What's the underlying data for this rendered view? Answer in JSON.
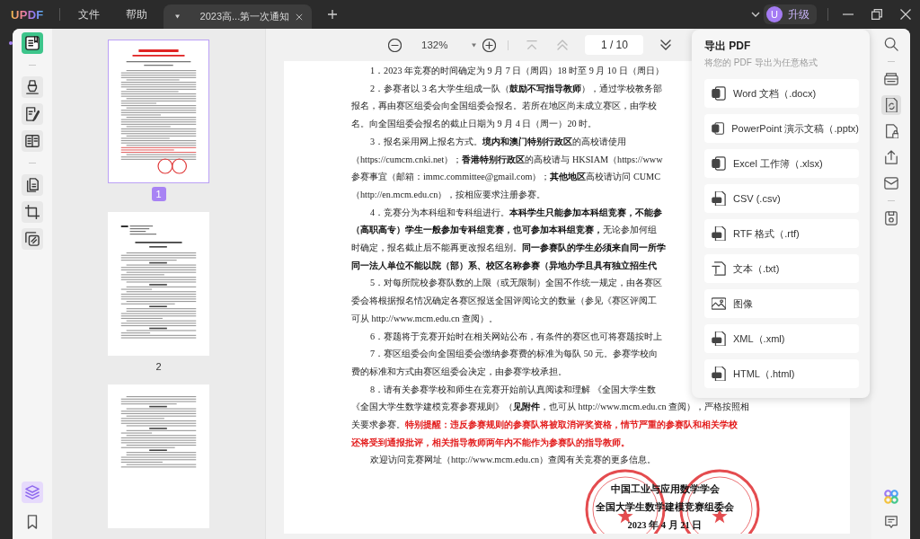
{
  "title_bar": {
    "logo": "UPDF",
    "menus": [
      {
        "label": "文件"
      },
      {
        "label": "帮助"
      }
    ],
    "tabs": [
      {
        "title": "2023高...第一次通知",
        "selected": true
      }
    ],
    "upgrade": {
      "avatar": "U",
      "label": "升级"
    }
  },
  "left_toolbar": {
    "groups": [
      {
        "tools": [
          {
            "selected": true
          }
        ]
      },
      {
        "tools": [
          {
            "selected": false
          },
          {
            "selected": false
          },
          {
            "selected": false
          }
        ]
      },
      {
        "tools": [
          {
            "selected": false
          },
          {
            "selected": false
          },
          {
            "selected": false
          }
        ]
      }
    ],
    "bottom_tools": [
      {
        "selected": true
      },
      {
        "selected": false
      }
    ]
  },
  "thumbnails": [
    {
      "label": "1",
      "selected": true
    },
    {
      "label": "2",
      "selected": false
    },
    {
      "selected": false
    }
  ],
  "doc_toolbar": {
    "zoom": "132%",
    "first_page": {
      "disabled": true
    },
    "previous_page": {
      "disabled": true
    },
    "page_field": {
      "value": "1 / 10"
    },
    "next_page": {
      "disabled": false
    }
  },
  "document": {
    "lines": [
      {
        "indent": true,
        "segments": [
          {
            "kind": "plain",
            "text": "1．2023 年竞赛的时间确定为 9 月 7 日（周四）18 时至 9 月 10 日（周日）"
          }
        ]
      },
      {
        "indent": true,
        "segments": [
          {
            "kind": "plain",
            "text": "2．参赛者以 3 名大学生组成一队（"
          },
          {
            "kind": "emphasis",
            "text": "鼓励不写指导教师"
          },
          {
            "kind": "plain",
            "text": "），通过学校教务部"
          }
        ]
      },
      {
        "indent": false,
        "segments": [
          {
            "kind": "plain",
            "text": "报名，再由赛区组委会向全国组委会报名。若所在地区尚未成立赛区，由学校"
          }
        ]
      },
      {
        "indent": false,
        "segments": [
          {
            "kind": "plain",
            "text": "名。向全国组委会报名的截止日期为 9 月 4 日（周一）20 时。"
          }
        ]
      },
      {
        "indent": true,
        "segments": [
          {
            "kind": "plain",
            "text": "3．报名采用网上报名方式。"
          },
          {
            "kind": "emphasis",
            "text": "境内和澳门特别行政区"
          },
          {
            "kind": "plain",
            "text": "的高校请使用"
          }
        ]
      },
      {
        "indent": false,
        "segments": [
          {
            "kind": "plain",
            "text": "（https://cumcm.cnki.net）；"
          },
          {
            "kind": "emphasis",
            "text": "香港特别行政区"
          },
          {
            "kind": "plain",
            "text": "的高校请与 HKSIAM（https://www"
          }
        ]
      },
      {
        "indent": false,
        "segments": [
          {
            "kind": "plain",
            "text": "参赛事宜（邮箱：immc.committee@gmail.com）；"
          },
          {
            "kind": "emphasis",
            "text": "其他地区"
          },
          {
            "kind": "plain",
            "text": "高校请访问 CUMC"
          }
        ]
      },
      {
        "indent": false,
        "segments": [
          {
            "kind": "plain",
            "text": "（http://en.mcm.edu.cn），按相应要求注册参赛。"
          }
        ]
      },
      {
        "indent": true,
        "segments": [
          {
            "kind": "plain",
            "text": "4．竞赛分为本科组和专科组进行。"
          },
          {
            "kind": "emphasis",
            "text": "本科学生只能参加本科组竞赛，不能参"
          }
        ]
      },
      {
        "indent": false,
        "segments": [
          {
            "kind": "emphasis",
            "text": "（高职高专）学生一般参加专科组竞赛，也可参加本科组竞赛，"
          },
          {
            "kind": "plain",
            "text": "无论参加何组"
          }
        ]
      },
      {
        "indent": false,
        "segments": [
          {
            "kind": "plain",
            "text": "时确定，报名截止后不能再更改报名组别。"
          },
          {
            "kind": "emphasis",
            "text": "同一参赛队的学生必须来自同一所学"
          }
        ]
      },
      {
        "indent": false,
        "segments": [
          {
            "kind": "emphasis",
            "text": "同一法人单位不能以院（部）系、校区名称参赛（异地办学且具有独立招生代"
          }
        ]
      },
      {
        "indent": true,
        "segments": [
          {
            "kind": "plain",
            "text": "5．对每所院校参赛队数的上限（或无限制）全国不作统一规定，由各赛区"
          }
        ]
      },
      {
        "indent": false,
        "segments": [
          {
            "kind": "plain",
            "text": "委会将根据报名情况确定各赛区报送全国评阅论文的数量（参见《赛区评阅工"
          }
        ]
      },
      {
        "indent": false,
        "segments": [
          {
            "kind": "plain",
            "text": "可从 http://www.mcm.edu.cn 查阅）。"
          }
        ]
      },
      {
        "indent": true,
        "segments": [
          {
            "kind": "plain",
            "text": "6．赛题将于竞赛开始时在相关网站公布，有条件的赛区也可将赛题按时上"
          }
        ]
      },
      {
        "indent": true,
        "segments": [
          {
            "kind": "plain",
            "text": "7．赛区组委会向全国组委会缴纳参赛费的标准为每队 50 元。参赛学校向"
          }
        ]
      },
      {
        "indent": false,
        "segments": [
          {
            "kind": "plain",
            "text": "费的标准和方式由赛区组委会决定，由参赛学校承担。"
          }
        ]
      },
      {
        "indent": true,
        "segments": [
          {
            "kind": "plain",
            "text": "8．请有关参赛学校和师生在竞赛开始前认真阅读和理解 《全国大学生数"
          }
        ]
      },
      {
        "indent": false,
        "segments": [
          {
            "kind": "plain",
            "text": "《全国大学生数学建模竞赛参赛规则》（"
          },
          {
            "kind": "emphasis",
            "text": "见附件"
          },
          {
            "kind": "plain",
            "text": "，也可从 http://www.mcm.edu.cn 查阅），严格按照相"
          }
        ]
      },
      {
        "indent": false,
        "segments": [
          {
            "kind": "plain",
            "text": "关要求参赛。"
          },
          {
            "kind": "warning",
            "text": "特别提醒：违反参赛规则的参赛队将被取消评奖资格，情节严重的参赛队和相关学校"
          }
        ]
      },
      {
        "indent": false,
        "segments": [
          {
            "kind": "warning",
            "text": "还将受到通报批评，相关指导教师两年内不能作为参赛队的指导教师。"
          }
        ]
      },
      {
        "indent": true,
        "segments": [
          {
            "kind": "plain",
            "text": "欢迎访问竞赛网址（http://www.mcm.edu.cn）查阅有关竞赛的更多信息。"
          }
        ]
      }
    ],
    "signature": [
      "中国工业与应用数学学会",
      "全国大学生数学建模竞赛组委会",
      "2023 年 4 月 21 日"
    ]
  },
  "export_panel": {
    "title": "导出 PDF",
    "subtitle": "将您的 PDF 导出为任意格式",
    "formats": [
      {
        "label": "Word 文档（.docx)",
        "kind": "office"
      },
      {
        "label": "PowerPoint 演示文稿（.pptx)",
        "kind": "office"
      },
      {
        "label": "Excel 工作簿（.xlsx)",
        "kind": "office"
      },
      {
        "label": "CSV (.csv)",
        "kind": "data"
      },
      {
        "label": "RTF 格式（.rtf)",
        "kind": "data"
      },
      {
        "label": "文本（.txt)",
        "kind": "text"
      },
      {
        "label": "图像",
        "kind": "image"
      },
      {
        "label": "XML（.xml)",
        "kind": "data"
      },
      {
        "label": "HTML（.html)",
        "kind": "data"
      }
    ]
  },
  "right_toolbar": {
    "groups": [
      {
        "tools": [
          {
            "selected": false
          }
        ]
      },
      {
        "tools": [
          {
            "selected": false
          },
          {
            "selected": true
          },
          {
            "selected": false
          },
          {
            "selected": false
          },
          {
            "selected": false
          }
        ]
      },
      {
        "tools": [
          {
            "selected": false
          }
        ]
      }
    ],
    "bottom_tools": [
      {
        "selected": false
      },
      {
        "selected": false
      }
    ]
  }
}
